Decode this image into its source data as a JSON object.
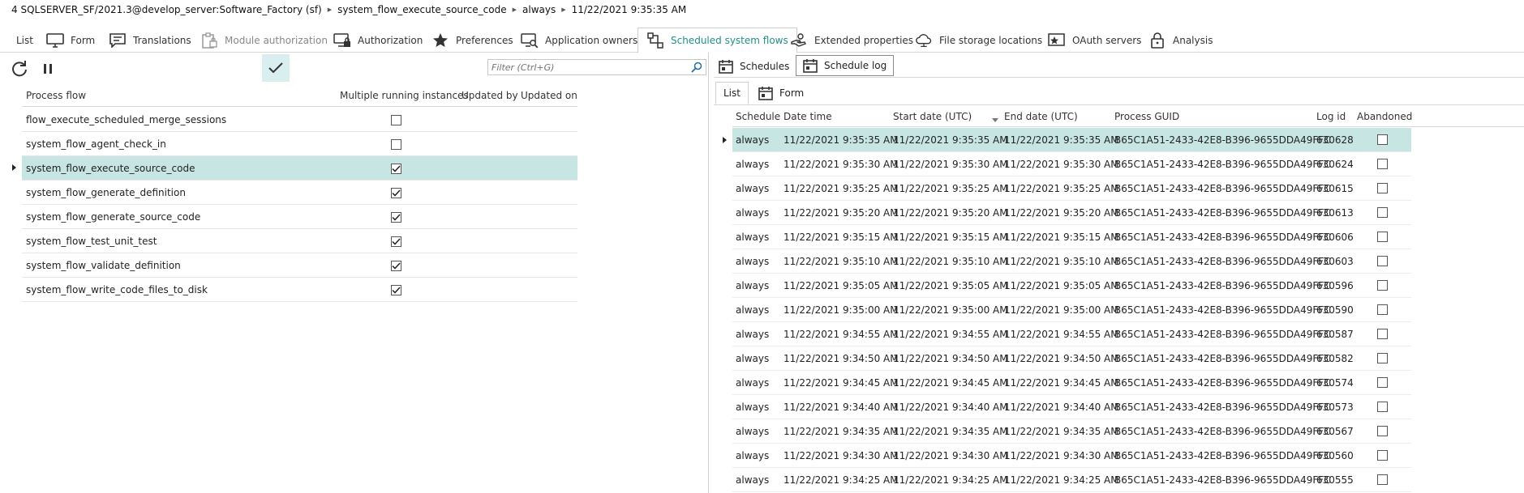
{
  "breadcrumb": [
    "4 SQLSERVER_SF/2021.3@develop_server:Software_Factory (sf)",
    "system_flow_execute_source_code",
    "always",
    "11/22/2021 9:35:35 AM"
  ],
  "main_tabs": [
    {
      "label": "List",
      "icon": "none",
      "state": "normal"
    },
    {
      "label": "Form",
      "icon": "monitor-icon",
      "state": "normal"
    },
    {
      "label": "Translations",
      "icon": "chat-icon",
      "state": "normal"
    },
    {
      "label": "Module authorization",
      "icon": "clipboard-lock-icon",
      "state": "disabled"
    },
    {
      "label": "Authorization",
      "icon": "monitor-lock-icon",
      "state": "normal"
    },
    {
      "label": "Preferences",
      "icon": "star-icon",
      "state": "normal"
    },
    {
      "label": "Application owners",
      "icon": "monitor-search-icon",
      "state": "normal"
    },
    {
      "label": "Scheduled system flows",
      "icon": "flow-icon",
      "state": "active"
    },
    {
      "label": "Extended properties",
      "icon": "hand-icon",
      "state": "normal"
    },
    {
      "label": "File storage locations",
      "icon": "cloud-icon",
      "state": "normal"
    },
    {
      "label": "OAuth servers",
      "icon": "star-box-icon",
      "state": "normal"
    },
    {
      "label": "Analysis",
      "icon": "lock-icon",
      "state": "normal"
    }
  ],
  "left": {
    "filter_placeholder": "Filter (Ctrl+G)",
    "columns": [
      "Process flow",
      "Multiple running instances",
      "Updated by",
      "Updated on"
    ],
    "rows": [
      {
        "name": "flow_execute_scheduled_merge_sessions",
        "multiple": false
      },
      {
        "name": "system_flow_agent_check_in",
        "multiple": false
      },
      {
        "name": "system_flow_execute_source_code",
        "multiple": true
      },
      {
        "name": "system_flow_generate_definition",
        "multiple": true
      },
      {
        "name": "system_flow_generate_source_code",
        "multiple": true
      },
      {
        "name": "system_flow_test_unit_test",
        "multiple": true
      },
      {
        "name": "system_flow_validate_definition",
        "multiple": true
      },
      {
        "name": "system_flow_write_code_files_to_disk",
        "multiple": true
      }
    ],
    "selected_index": 2
  },
  "right": {
    "subtabs": [
      "Schedules",
      "Schedule log"
    ],
    "active_subtab": "Schedule log",
    "inner_tabs": [
      "List",
      "Form"
    ],
    "columns": [
      "Schedule",
      "Date time",
      "Start date (UTC)",
      "End date (UTC)",
      "Process GUID",
      "Log id",
      "Abandoned"
    ],
    "rows": [
      {
        "schedule": "always",
        "dt": "11/22/2021 9:35:35 AM",
        "start": "11/22/2021 9:35:35 AM",
        "end": "11/22/2021 9:35:35 AM",
        "guid": "B65C1A51-2433-42E8-B396-9655DDA49FFC",
        "log": "630628"
      },
      {
        "schedule": "always",
        "dt": "11/22/2021 9:35:30 AM",
        "start": "11/22/2021 9:35:30 AM",
        "end": "11/22/2021 9:35:30 AM",
        "guid": "B65C1A51-2433-42E8-B396-9655DDA49FFC",
        "log": "630624"
      },
      {
        "schedule": "always",
        "dt": "11/22/2021 9:35:25 AM",
        "start": "11/22/2021 9:35:25 AM",
        "end": "11/22/2021 9:35:25 AM",
        "guid": "B65C1A51-2433-42E8-B396-9655DDA49FFC",
        "log": "630615"
      },
      {
        "schedule": "always",
        "dt": "11/22/2021 9:35:20 AM",
        "start": "11/22/2021 9:35:20 AM",
        "end": "11/22/2021 9:35:20 AM",
        "guid": "B65C1A51-2433-42E8-B396-9655DDA49FFC",
        "log": "630613"
      },
      {
        "schedule": "always",
        "dt": "11/22/2021 9:35:15 AM",
        "start": "11/22/2021 9:35:15 AM",
        "end": "11/22/2021 9:35:15 AM",
        "guid": "B65C1A51-2433-42E8-B396-9655DDA49FFC",
        "log": "630606"
      },
      {
        "schedule": "always",
        "dt": "11/22/2021 9:35:10 AM",
        "start": "11/22/2021 9:35:10 AM",
        "end": "11/22/2021 9:35:10 AM",
        "guid": "B65C1A51-2433-42E8-B396-9655DDA49FFC",
        "log": "630603"
      },
      {
        "schedule": "always",
        "dt": "11/22/2021 9:35:05 AM",
        "start": "11/22/2021 9:35:05 AM",
        "end": "11/22/2021 9:35:05 AM",
        "guid": "B65C1A51-2433-42E8-B396-9655DDA49FFC",
        "log": "630596"
      },
      {
        "schedule": "always",
        "dt": "11/22/2021 9:35:00 AM",
        "start": "11/22/2021 9:35:00 AM",
        "end": "11/22/2021 9:35:00 AM",
        "guid": "B65C1A51-2433-42E8-B396-9655DDA49FFC",
        "log": "630590"
      },
      {
        "schedule": "always",
        "dt": "11/22/2021 9:34:55 AM",
        "start": "11/22/2021 9:34:55 AM",
        "end": "11/22/2021 9:34:55 AM",
        "guid": "B65C1A51-2433-42E8-B396-9655DDA49FFC",
        "log": "630587"
      },
      {
        "schedule": "always",
        "dt": "11/22/2021 9:34:50 AM",
        "start": "11/22/2021 9:34:50 AM",
        "end": "11/22/2021 9:34:50 AM",
        "guid": "B65C1A51-2433-42E8-B396-9655DDA49FFC",
        "log": "630582"
      },
      {
        "schedule": "always",
        "dt": "11/22/2021 9:34:45 AM",
        "start": "11/22/2021 9:34:45 AM",
        "end": "11/22/2021 9:34:45 AM",
        "guid": "B65C1A51-2433-42E8-B396-9655DDA49FFC",
        "log": "630574"
      },
      {
        "schedule": "always",
        "dt": "11/22/2021 9:34:40 AM",
        "start": "11/22/2021 9:34:40 AM",
        "end": "11/22/2021 9:34:40 AM",
        "guid": "B65C1A51-2433-42E8-B396-9655DDA49FFC",
        "log": "630573"
      },
      {
        "schedule": "always",
        "dt": "11/22/2021 9:34:35 AM",
        "start": "11/22/2021 9:34:35 AM",
        "end": "11/22/2021 9:34:35 AM",
        "guid": "B65C1A51-2433-42E8-B396-9655DDA49FFC",
        "log": "630567"
      },
      {
        "schedule": "always",
        "dt": "11/22/2021 9:34:30 AM",
        "start": "11/22/2021 9:34:30 AM",
        "end": "11/22/2021 9:34:30 AM",
        "guid": "B65C1A51-2433-42E8-B396-9655DDA49FFC",
        "log": "630560"
      },
      {
        "schedule": "always",
        "dt": "11/22/2021 9:34:25 AM",
        "start": "11/22/2021 9:34:25 AM",
        "end": "11/22/2021 9:34:25 AM",
        "guid": "B65C1A51-2433-42E8-B396-9655DDA49FFC",
        "log": "630555"
      }
    ],
    "selected_index": 0
  },
  "colors": {
    "accent": "#1f8f8a",
    "selection": "#c7e6e3"
  }
}
